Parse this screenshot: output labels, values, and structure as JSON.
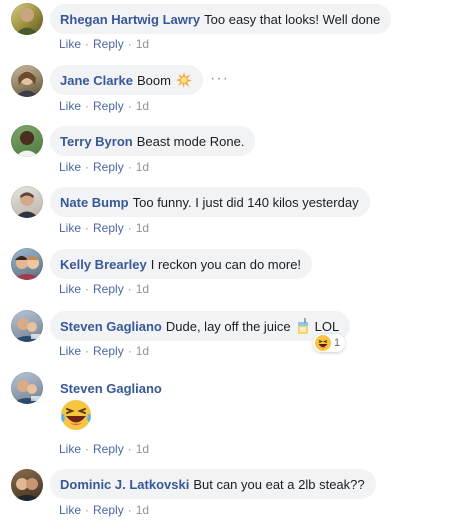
{
  "actions": {
    "like": "Like",
    "reply": "Reply",
    "sep": "·"
  },
  "comments": [
    {
      "author": "Rhegan Hartwig Lawry",
      "text": "Too easy that looks! Well done",
      "time": "1d"
    },
    {
      "author": "Jane Clarke",
      "text": "Boom",
      "time": "1d",
      "emoji": "collision-icon",
      "more_label": "···"
    },
    {
      "author": "Terry Byron",
      "text": "Beast mode Rone.",
      "time": "1d"
    },
    {
      "author": "Nate Bump",
      "text": "Too funny. I just did 140 kilos yesterday",
      "time": "1d"
    },
    {
      "author": "Kelly Brearley",
      "text": "I reckon you can do more!",
      "time": "1d"
    },
    {
      "author": "Steven Gagliano",
      "text_before": "Dude, lay off the juice",
      "text_after": "LOL",
      "time": "1d",
      "emoji": "juice-box-icon",
      "reaction": {
        "icon": "haha-reaction-icon",
        "count": "1"
      }
    },
    {
      "author": "Steven Gagliano",
      "text": "",
      "time": "1d",
      "emoji": "laughing-tears-icon"
    },
    {
      "author": "Dominic J. Latkovski",
      "text": "But can you eat a 2lb steak??",
      "time": "1d"
    }
  ]
}
